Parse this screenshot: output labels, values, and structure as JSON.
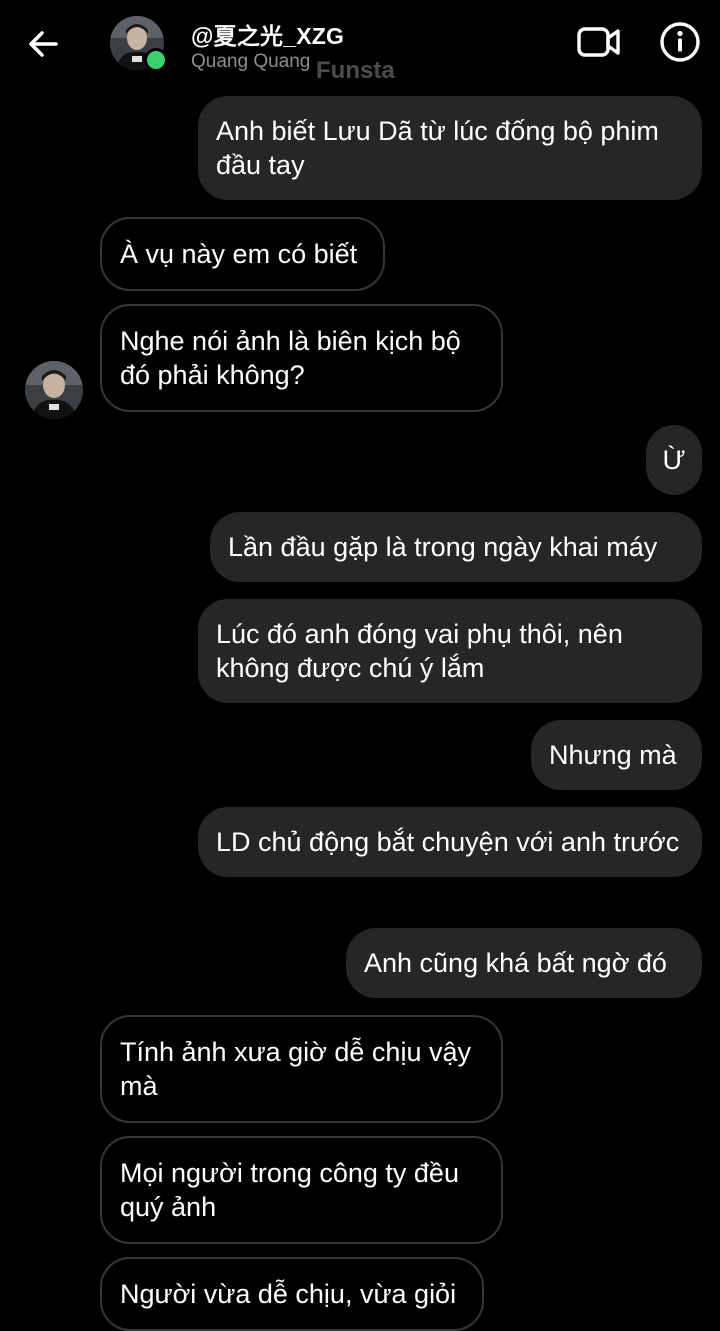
{
  "header": {
    "username": "@夏之光_XZG",
    "subtitle": "Quang Quang",
    "watermark": "Funsta",
    "back_icon": "arrow-left-icon",
    "video_icon": "video-camera-icon",
    "info_icon": "info-icon",
    "online_color": "#3bd16f"
  },
  "messages": [
    {
      "direction": "out",
      "text": "Anh biết Lưu Dã từ lúc đống bộ phim đầu tay"
    },
    {
      "direction": "in",
      "text": "À vụ này em có biết"
    },
    {
      "direction": "in",
      "text": "Nghe nói ảnh là biên kịch bộ đó phải không?"
    },
    {
      "direction": "out",
      "text": "Ừ"
    },
    {
      "direction": "out",
      "text": "Lần đầu gặp là trong ngày khai máy"
    },
    {
      "direction": "out",
      "text": "Lúc đó anh đóng vai phụ thôi, nên không được chú ý lắm"
    },
    {
      "direction": "out",
      "text": "Nhưng mà"
    },
    {
      "direction": "out",
      "text": "LD chủ động bắt chuyện với anh trước"
    },
    {
      "direction": "out",
      "text": "Anh cũng khá bất ngờ đó"
    },
    {
      "direction": "in",
      "text": "Tính ảnh xưa giờ dễ chịu vậy mà"
    },
    {
      "direction": "in",
      "text": "Mọi người trong công ty đều quý ảnh"
    },
    {
      "direction": "in",
      "text": "Người vừa dễ chịu, vừa giỏi"
    }
  ],
  "colors": {
    "background": "#000000",
    "outgoing_bubble": "#262626",
    "incoming_border": "#363636"
  }
}
